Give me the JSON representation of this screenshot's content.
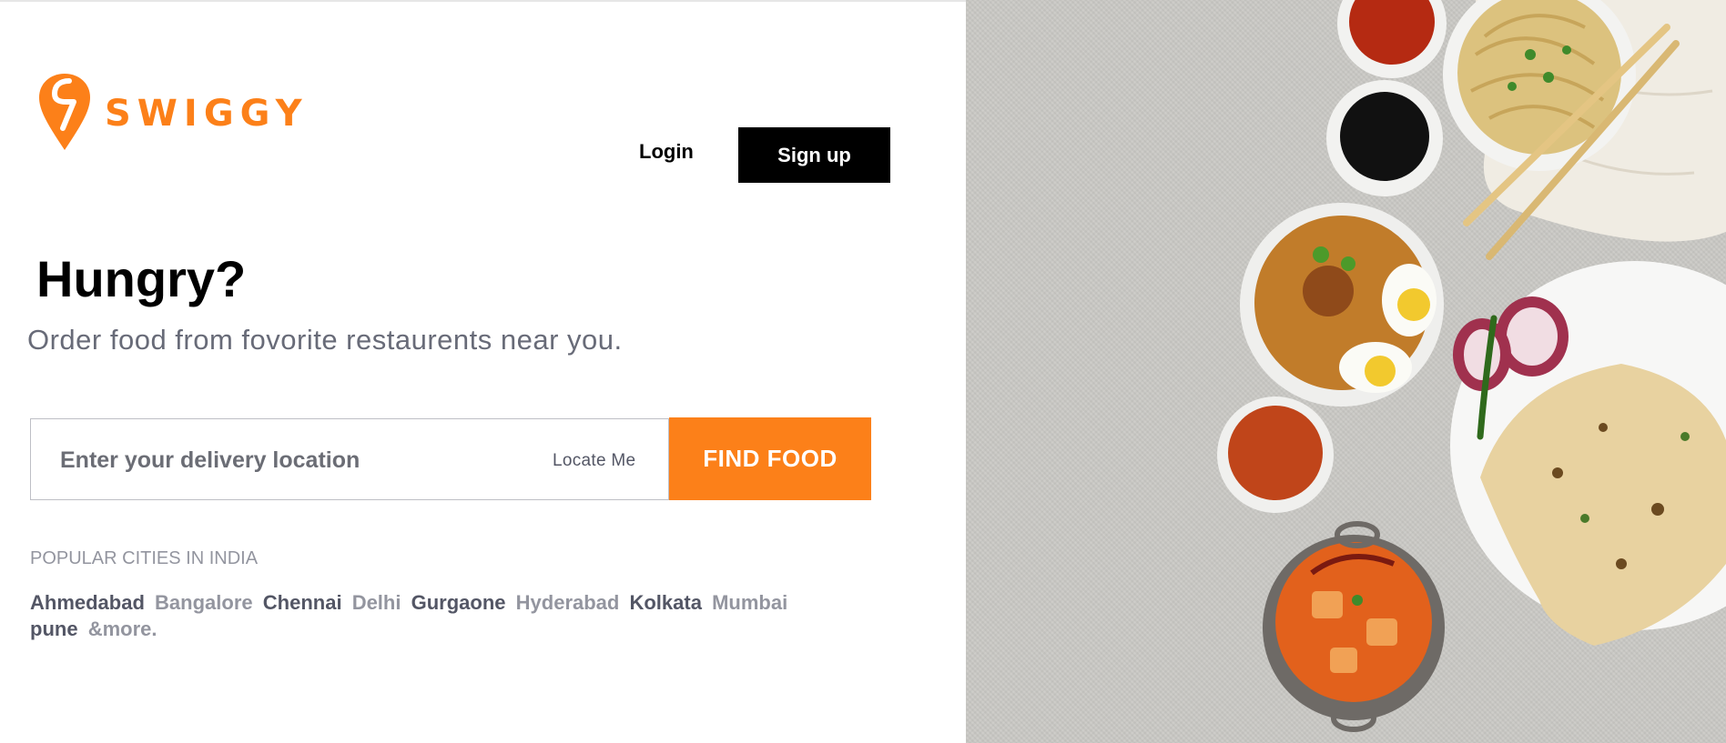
{
  "brand": {
    "name": "SWIGGY",
    "color": "#fc8019"
  },
  "header": {
    "login_label": "Login",
    "signup_label": "Sign up"
  },
  "hero": {
    "headline": "Hungry?",
    "subheadline": "Order food from fovorite restaurents near you."
  },
  "search": {
    "placeholder": "Enter your delivery location",
    "value": "",
    "locate_label": "Locate Me",
    "find_label": "FIND FOOD"
  },
  "popular": {
    "title": "POPULAR CITIES IN INDIA",
    "cities": [
      "Ahmedabad",
      "Bangalore",
      "Chennai",
      "Delhi",
      "Gurgaone",
      "Hyderabad",
      "Kolkata",
      "Mumbai",
      "pune"
    ],
    "more_label": "&more."
  },
  "icons": {
    "logo": "swiggy-logo-icon",
    "hero_image": "food-platter-image"
  },
  "colors": {
    "accent": "#fc8019",
    "dark_text": "#535665",
    "light_text": "#93959f",
    "button_dark": "#000000"
  }
}
